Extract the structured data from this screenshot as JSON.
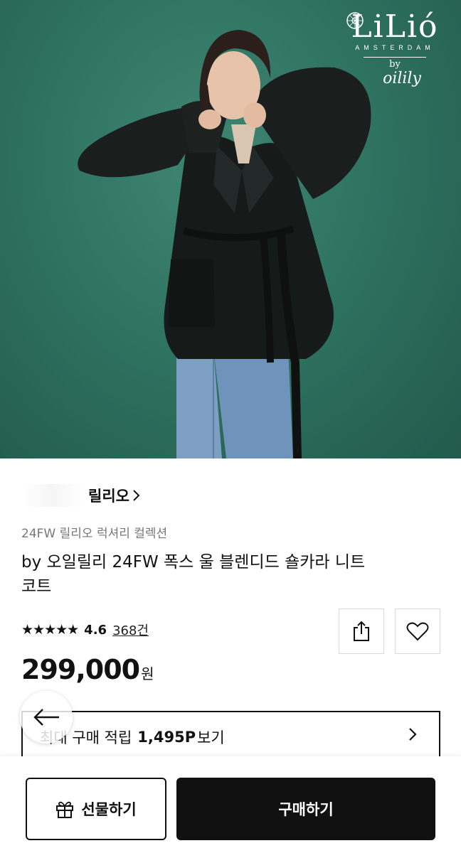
{
  "hero": {
    "brand_name": "LiLió",
    "brand_sub": "AMSTERDAM",
    "brand_by": "by",
    "brand_partner": "oilily",
    "background_color": "#2f7361"
  },
  "product": {
    "store_name": "릴리오",
    "collection": "24FW 릴리오 럭셔리 컬렉션",
    "title": "by 오일릴리 24FW 폭스 울 블렌디드 숄카라 니트 코트",
    "rating_stars": "★★★★★",
    "rating_score": "4.6",
    "rating_value": 4.6,
    "review_count": "368건",
    "price_value": "299,000",
    "price_unit": "원"
  },
  "points": {
    "prefix": "최대 구매 적립",
    "amount": "1,495P",
    "suffix": "보기"
  },
  "actions": {
    "gift_label": "선물하기",
    "buy_label": "구매하기"
  },
  "icons": {
    "share": "share-icon",
    "wish": "heart-icon",
    "back": "arrow-left-icon",
    "gift": "gift-icon",
    "chevron": "chevron-right-icon"
  },
  "colors": {
    "accent": "#111111",
    "muted_text": "#777777",
    "hero_green": "#2f7361"
  }
}
